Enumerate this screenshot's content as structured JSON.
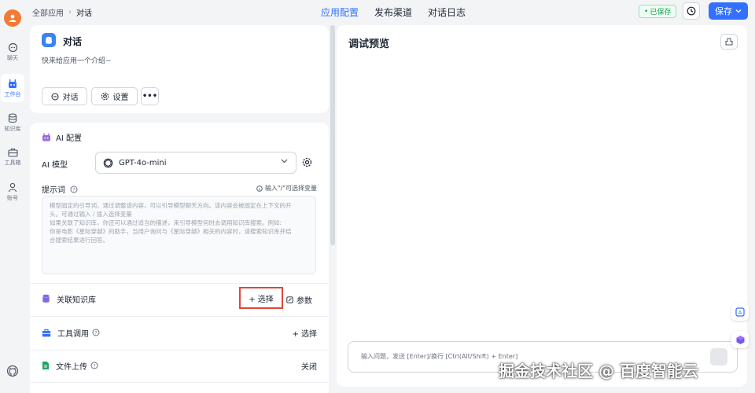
{
  "nav": {
    "items": [
      {
        "label": "聊天",
        "icon": "chat-icon"
      },
      {
        "label": "工作台",
        "icon": "robot-icon"
      },
      {
        "label": "知识库",
        "icon": "database-icon"
      },
      {
        "label": "工具箱",
        "icon": "toolbox-icon"
      },
      {
        "label": "账号",
        "icon": "user-icon"
      }
    ],
    "active_index": 1
  },
  "breadcrumb": {
    "root": "全部应用",
    "current": "对话"
  },
  "tabs": [
    {
      "label": "应用配置",
      "active": true
    },
    {
      "label": "发布渠道",
      "active": false
    },
    {
      "label": "对话日志",
      "active": false
    }
  ],
  "header": {
    "saved_status": "已保存",
    "save_label": "保存"
  },
  "app": {
    "name": "对话",
    "description": "快来给应用一个介绍~",
    "chat_button": "对话",
    "settings_button": "设置",
    "more_button": "•••"
  },
  "ai_config": {
    "title": "AI 配置",
    "model_label": "AI 模型",
    "model_value": "GPT-4o-mini",
    "prompt_label": "提示词",
    "prompt_hint": "输入\"/\"可选择变量",
    "prompt_placeholder": [
      "模型固定的引导词，通过调整该内容，可以引导模型聊天方向。该内容会被固定在上下文的开",
      "头。可通过输入 / 插入选择变量",
      "如果关联了知识库，你还可以通过适当的描述，来引导模型何时去调用知识库搜索。例如:",
      "你是电影《星际穿越》的助手，当用户询问与《星际穿越》相关的内容时，请搜索知识库并结",
      "合搜索结果进行回答。"
    ]
  },
  "knowledge": {
    "title": "关联知识库",
    "select_label": "+ 选择",
    "params_label": "参数"
  },
  "tools": {
    "title": "工具调用",
    "select_label": "+ 选择"
  },
  "file_upload": {
    "title": "文件上传",
    "status": "关闭"
  },
  "preview": {
    "title": "调试预览",
    "input_placeholder": "输入问题，发送 [Enter]/换行 [Ctrl(Alt/Shift) + Enter]"
  },
  "watermark": "掘金技术社区 @ 百度智能云",
  "colors": {
    "accent": "#3370ff",
    "saved": "#16a34a",
    "highlight": "#e0463a"
  }
}
